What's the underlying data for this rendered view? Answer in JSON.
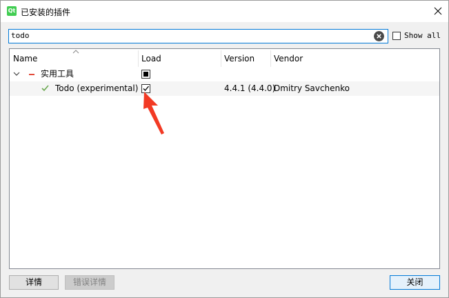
{
  "window": {
    "title": "已安装的插件",
    "app_icon_text": "Qt"
  },
  "search": {
    "value": "todo",
    "placeholder": ""
  },
  "show_all": {
    "label": "Show all",
    "checked": false
  },
  "columns": {
    "name": "Name",
    "load": "Load",
    "version": "Version",
    "vendor": "Vendor"
  },
  "tree": {
    "category": {
      "label": "实用工具",
      "expanded": true,
      "load_state": "partial"
    },
    "plugin": {
      "name": "Todo (experimental)",
      "load": true,
      "version": "4.4.1 (4.4.0)",
      "vendor": "Dmitry Savchenko",
      "status_color": "#6aa84f"
    }
  },
  "buttons": {
    "details": "详情",
    "error_details": "错误详情",
    "close": "关闭"
  },
  "colors": {
    "accent": "#0078d7",
    "annotation_arrow": "#f23a24",
    "category_dash": "#e24b3b"
  },
  "icons": [
    "qt-app-icon",
    "close-icon",
    "clear-search-icon",
    "sort-caret-icon",
    "expand-chevron-icon",
    "check-icon",
    "annotation-arrow"
  ]
}
